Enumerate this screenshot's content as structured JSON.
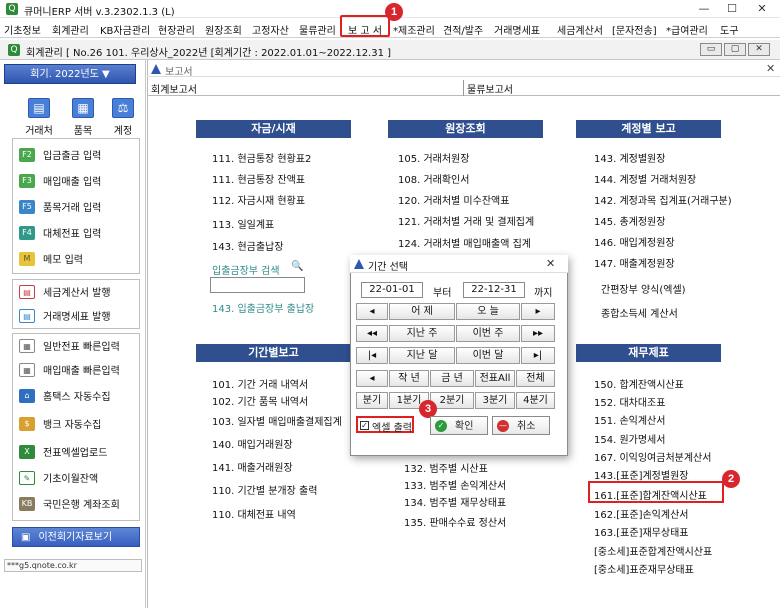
{
  "titlebar": {
    "title": "큐머니ERP 서버 v.3.2302.1.3 (L)",
    "app_icon": "Q",
    "min": "—",
    "max": "☐",
    "close": "✕"
  },
  "menubar": {
    "items": [
      "기초정보",
      "회계관리",
      "KB자금관리",
      "현장관리",
      "원장조회",
      "고정자산",
      "물류관리",
      "보 고 서",
      "*제조관리",
      "견적/발주",
      "거래명세표",
      "세금계산서",
      "[문자전송]",
      "*급여관리",
      "도구"
    ]
  },
  "subbar": {
    "title": "회계관리 [ No.26   101. 우리상사_2022년 [회계기간 : 2022.01.01~2022.12.31 ]"
  },
  "sidebar": {
    "period": "회기. 2022년도 ▼",
    "big_buttons": [
      "거래처",
      "품목",
      "계정"
    ],
    "group1": [
      {
        "key": "F2",
        "label": "입금출금 입력",
        "color": "#49a84e"
      },
      {
        "key": "F3",
        "label": "매입매출 입력",
        "color": "#49a84e"
      },
      {
        "key": "F5",
        "label": "품목거래 입력",
        "color": "#3a86c8"
      },
      {
        "key": "F4",
        "label": "대체전표 입력",
        "color": "#2f9a8a"
      },
      {
        "key": "M",
        "label": "메모 입력",
        "color": "#e8c23a"
      }
    ],
    "group2": [
      {
        "label": "세금계산서 발행",
        "color": "#c84040"
      },
      {
        "label": "거래명세표 발행",
        "color": "#3a86c8"
      }
    ],
    "group3": [
      {
        "label": "일반전표 빠른입력",
        "color": "#888888"
      },
      {
        "label": "매입매출 빠른입력",
        "color": "#888888"
      },
      {
        "label": "홈택스 자동수집",
        "color": "#2f6fc0"
      },
      {
        "label": "뱅크 자동수집",
        "color": "#d9a030"
      },
      {
        "label": "전표엑셀업로드",
        "color": "#2e8b3c"
      },
      {
        "label": "기초이월잔액",
        "color": "#2e8b3c"
      },
      {
        "label": "국민은행 계좌조회",
        "color": "#8a7a60"
      }
    ],
    "prev_btn": "이전회기자료보기",
    "status": "***g5.qnote.co.kr"
  },
  "report_window": {
    "title": "보고서",
    "tabs": [
      "회계보고서",
      "물류보고서"
    ],
    "sections": {
      "fund": {
        "head": "자금/시재",
        "items": [
          "111. 현금통장 현황표2",
          "111. 현금통장 잔액표",
          "112. 자금시재 현황표",
          "113. 일일계표",
          "143. 현금출납장"
        ],
        "search_label": "입출금장부 검색",
        "search_item": "143. 입출금장부 출납장"
      },
      "ledger": {
        "head": "원장조회",
        "items": [
          "105. 거래처원장",
          "108. 거래확인서",
          "120. 거래처별 미수잔액표",
          "121. 거래처별 거래 및 결제집계",
          "124. 거래처별 매입매출액 집계"
        ]
      },
      "account": {
        "head": "계정별 보고",
        "items": [
          "143. 계정별원장",
          "144. 계정별 거래처원장",
          "142. 계정과목 집계표(거래구분)",
          "145. 총계정원장",
          "146. 매입계정원장",
          "147. 매출계정원장",
          "간편장부 양식(엑셀)",
          "종합소득세 계산서"
        ]
      },
      "period": {
        "head": "기간별보고",
        "items": [
          "101. 기간 거래 내역서",
          "102. 기간 품목 내역서",
          "103. 일자별 매입매출결제집계",
          "140. 매입거래원장",
          "141. 매출거래원장",
          "110. 기간별 분개장 출력",
          "110. 대체전표 내역"
        ]
      },
      "middle_bottom": {
        "items": [
          "132. 범주별 시산표",
          "133. 범주별 손익계산서",
          "134. 범주별 재무상태표",
          "135. 판매수수료 정산서"
        ]
      },
      "finance": {
        "head": "재무제표",
        "items": [
          "150. 합계잔액시산표",
          "152. 대차대조표",
          "151. 손익계산서",
          "154. 원가명세서",
          "167. 이익잉여금처분계산서",
          "143.[표준]계정별원장",
          "161.[표준]합계잔액시산표",
          "162.[표준]손익계산서",
          "163.[표준]재무상태표",
          "[중소세]표준합계잔액시산표",
          "[중소세]표준재무상태표"
        ]
      }
    }
  },
  "dialog": {
    "title": "기간 선택",
    "from_date": "22-01-01",
    "from_label": "부터",
    "to_date": "22-12-31",
    "to_label": "까지",
    "row1": [
      "◂",
      "어 제",
      "오 늘",
      "▸"
    ],
    "row2": [
      "◂◂",
      "지난 주",
      "이번 주",
      "▸▸"
    ],
    "row3": [
      "|◂",
      "지난 달",
      "이번 달",
      "▸|"
    ],
    "row4": [
      "◂",
      "작 년",
      "금 년",
      "전표All",
      "전체"
    ],
    "row5": [
      "분기",
      "1분기",
      "2분기",
      "3분기",
      "4분기"
    ],
    "excel_label": "엑셀 출력",
    "ok": "확인",
    "cancel": "취소"
  },
  "badges": [
    "1",
    "2",
    "3"
  ]
}
